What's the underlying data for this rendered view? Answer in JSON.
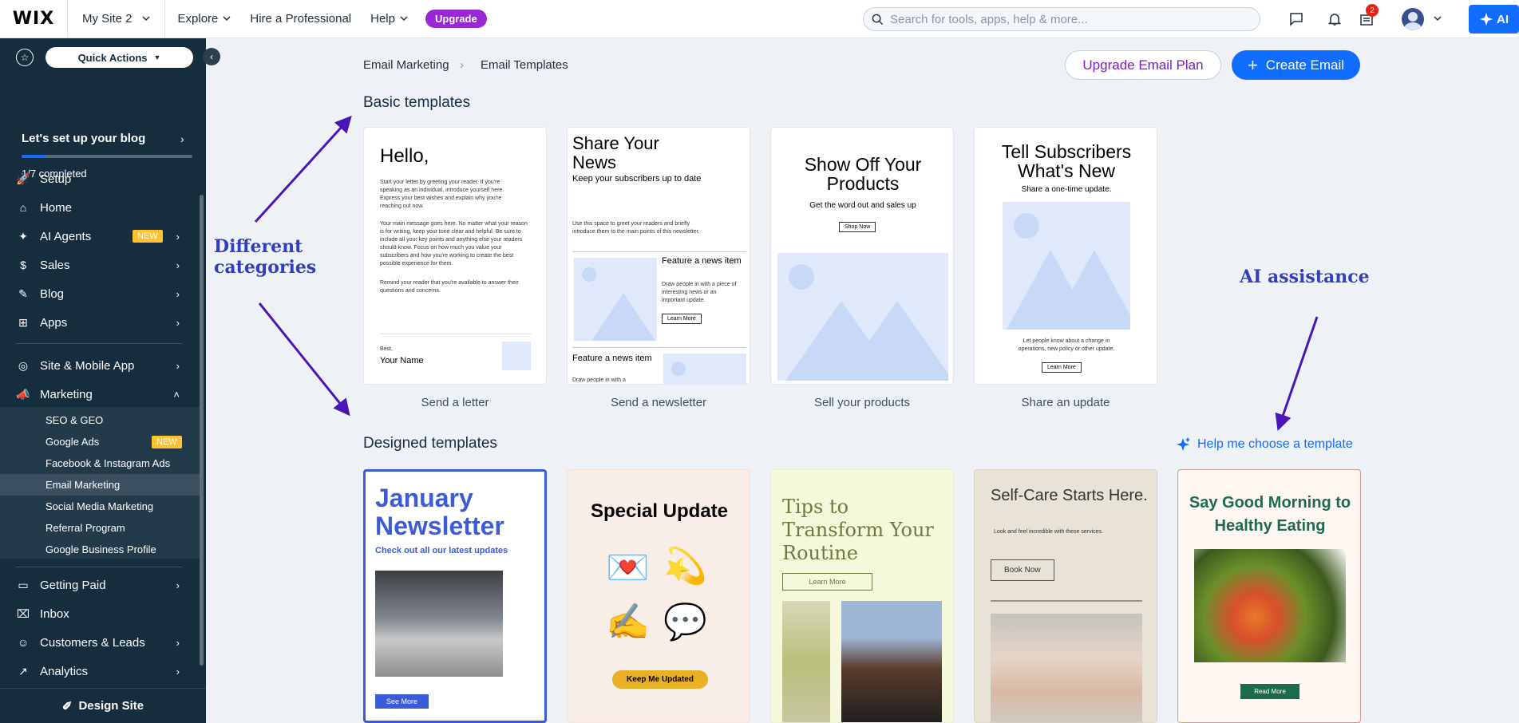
{
  "topbar": {
    "logo": "WIX",
    "site_name": "My Site 2",
    "nav": [
      "Explore",
      "Hire a Professional",
      "Help"
    ],
    "upgrade": "Upgrade",
    "search_placeholder": "Search for tools, apps, help & more...",
    "notification_count": "2",
    "ai_label": "AI"
  },
  "sidebar": {
    "quick_actions": "Quick Actions",
    "setup_title": "Let's set up your blog",
    "progress_text": "1/7 completed",
    "progress": 0.14,
    "items": [
      {
        "label": "Setup",
        "icon": "rocket-icon"
      },
      {
        "label": "Home",
        "icon": "home-icon"
      },
      {
        "label": "AI Agents",
        "icon": "sparkle-icon",
        "badge": "NEW"
      },
      {
        "label": "Sales",
        "icon": "dollar-icon"
      },
      {
        "label": "Blog",
        "icon": "pencil-icon"
      },
      {
        "label": "Apps",
        "icon": "grid-icon"
      }
    ],
    "items2": [
      {
        "label": "Site & Mobile App",
        "icon": "globe-icon"
      },
      {
        "label": "Marketing",
        "icon": "megaphone-icon"
      }
    ],
    "marketing_sub": [
      "SEO & GEO",
      "Google Ads",
      "Facebook & Instagram Ads",
      "Email Marketing",
      "Social Media Marketing",
      "Referral Program",
      "Google Business Profile"
    ],
    "new_badge": "NEW",
    "items3": [
      {
        "label": "Getting Paid",
        "icon": "card-icon"
      },
      {
        "label": "Inbox",
        "icon": "inbox-icon"
      },
      {
        "label": "Customers & Leads",
        "icon": "people-icon"
      },
      {
        "label": "Analytics",
        "icon": "chart-icon"
      }
    ],
    "design_site": "Design Site"
  },
  "breadcrumb": {
    "parent": "Email Marketing",
    "current": "Email Templates"
  },
  "actions": {
    "upgrade_plan": "Upgrade Email Plan",
    "create": "Create Email"
  },
  "basic": {
    "title": "Basic templates",
    "cards": [
      {
        "caption": "Send a letter",
        "heading": "Hello,",
        "p1": "Start your letter by greeting your reader. If you're speaking as an individual, introduce yourself here. Express your best wishes and explain why you're reaching out now.",
        "p2": "Your main message goes here. No matter what your reason is for writing, keep your tone clear and helpful. Be sure to include all your key points and anything else your readers should know. Focus on how much you value your subscribers and how you're working to create the best possible experience for them.",
        "p3": "Remind your reader that you're available to answer their questions and concerns.",
        "sign1": "Best,",
        "sign2": "Your Name"
      },
      {
        "caption": "Send a newsletter",
        "heading": "Share Your News",
        "sub": "Keep your subscribers up to date",
        "p1": "Use this space to greet your readers and briefly introduce them to the main points of this newsletter.",
        "f1": "Feature a news item",
        "f1text": "Draw people in with a piece of interesting news or an important update.",
        "btn": "Learn More",
        "f2": "Feature a news item",
        "f2text": "Draw people in with a"
      },
      {
        "caption": "Sell your products",
        "heading": "Show Off Your Products",
        "sub": "Get the word out and sales up",
        "btn": "Shop Now"
      },
      {
        "caption": "Share an update",
        "heading": "Tell Subscribers What's New",
        "sub": "Share a one-time update.",
        "p1": "Let people know about a change in operations, new policy or other update.",
        "btn": "Learn More"
      }
    ]
  },
  "designed": {
    "title": "Designed templates",
    "help": "Help me choose a template",
    "cards": [
      {
        "title": "January Newsletter",
        "sub": "Check out all our latest updates",
        "btn": "See More"
      },
      {
        "title": "Special Update",
        "btn": "Keep Me Updated",
        "emojis": [
          "💌",
          "💫",
          "✍️",
          "💬"
        ]
      },
      {
        "title": "Tips to Transform Your Routine",
        "btn": "Learn More"
      },
      {
        "title": "Self-Care Starts Here.",
        "sub": "Look and feel incredible with these services.",
        "btn": "Book Now"
      },
      {
        "title": "Say Good Morning to Healthy Eating",
        "btn": "Read More"
      }
    ]
  },
  "annotations": {
    "categories_1": "Different",
    "categories_2": "categories",
    "ai": "AI assistance"
  },
  "colors": {
    "accent": "#116dff",
    "sidebar": "#162d3d",
    "annotation": "#2f3fbf",
    "arrow": "#4b16b8"
  }
}
